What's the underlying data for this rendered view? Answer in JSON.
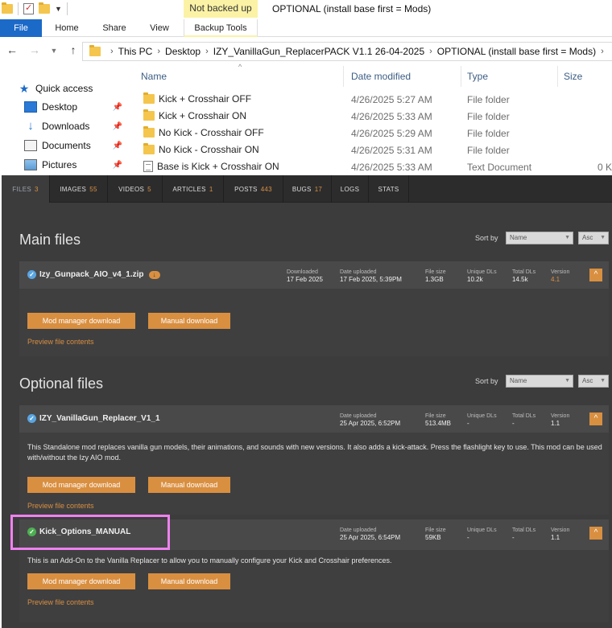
{
  "explorer": {
    "manage_tab": "Not backed up",
    "window_title": "OPTIONAL (install base first = Mods)",
    "ribbon_tabs": {
      "file": "File",
      "home": "Home",
      "share": "Share",
      "view": "View",
      "backup_tools": "Backup Tools"
    },
    "breadcrumb": [
      "This PC",
      "Desktop",
      "IZY_VanillaGun_ReplacerPACK V1.1 26-04-2025",
      "OPTIONAL (install base first = Mods)"
    ],
    "nav_pane": {
      "quick_access": "Quick access",
      "items": [
        "Desktop",
        "Downloads",
        "Documents",
        "Pictures"
      ]
    },
    "columns": {
      "name": "Name",
      "date": "Date modified",
      "type": "Type",
      "size": "Size"
    },
    "files": [
      {
        "name": "Kick + Crosshair OFF",
        "date": "4/26/2025 5:27 AM",
        "type": "File folder",
        "size": ""
      },
      {
        "name": "Kick + Crosshair ON",
        "date": "4/26/2025 5:33 AM",
        "type": "File folder",
        "size": ""
      },
      {
        "name": "No Kick - Crosshair OFF",
        "date": "4/26/2025 5:29 AM",
        "type": "File folder",
        "size": ""
      },
      {
        "name": "No Kick - Crosshair ON",
        "date": "4/26/2025 5:31 AM",
        "type": "File folder",
        "size": ""
      },
      {
        "name": "Base is Kick + Crosshair ON",
        "date": "4/26/2025 5:33 AM",
        "type": "Text Document",
        "size": "0 K"
      }
    ]
  },
  "nexus": {
    "tabs": [
      {
        "label": "FILES",
        "count": "3"
      },
      {
        "label": "IMAGES",
        "count": "55"
      },
      {
        "label": "VIDEOS",
        "count": "5"
      },
      {
        "label": "ARTICLES",
        "count": "1"
      },
      {
        "label": "POSTS",
        "count": "443"
      },
      {
        "label": "BUGS",
        "count": "17"
      },
      {
        "label": "LOGS",
        "count": ""
      },
      {
        "label": "STATS",
        "count": ""
      }
    ],
    "sort_by": "Sort by",
    "sort_field": "Name",
    "sort_order": "Asc",
    "main_title": "Main files",
    "optional_title": "Optional files",
    "labels": {
      "downloaded": "Downloaded",
      "date_uploaded": "Date uploaded",
      "file_size": "File size",
      "unique_dls": "Unique DLs",
      "total_dls": "Total DLs",
      "version": "Version",
      "mod_manager": "Mod manager download",
      "manual": "Manual download",
      "preview": "Preview file contents"
    },
    "main_file": {
      "name": "Izy_Gunpack_AIO_v4_1.zip",
      "downloaded": "17 Feb 2025",
      "date_uploaded": "17 Feb 2025, 5:39PM",
      "file_size": "1.3GB",
      "unique_dls": "10.2k",
      "total_dls": "14.5k",
      "version": "4.1"
    },
    "optional_files": [
      {
        "name": "IZY_VanillaGun_Replacer_V1_1",
        "date_uploaded": "25 Apr 2025, 6:52PM",
        "file_size": "513.4MB",
        "unique_dls": "-",
        "total_dls": "-",
        "version": "1.1",
        "description": "This Standalone mod replaces vanilla gun models, their animations, and sounds with new versions. It also adds a kick-attack. Press the flashlight key to use. This mod can be used with/without the Izy AIO mod."
      },
      {
        "name": "Kick_Options_MANUAL",
        "date_uploaded": "25 Apr 2025, 6:54PM",
        "file_size": "59KB",
        "unique_dls": "-",
        "total_dls": "-",
        "version": "1.1",
        "description": "This is an Add-On to the Vanilla Replacer to allow you to manually configure your Kick and Crosshair preferences."
      }
    ]
  },
  "colors": {
    "accent": "#d98f40",
    "highlight": "#ee82ee",
    "ribbon_file": "#1c6ac8",
    "panel_bg": "#3c3c3d"
  }
}
